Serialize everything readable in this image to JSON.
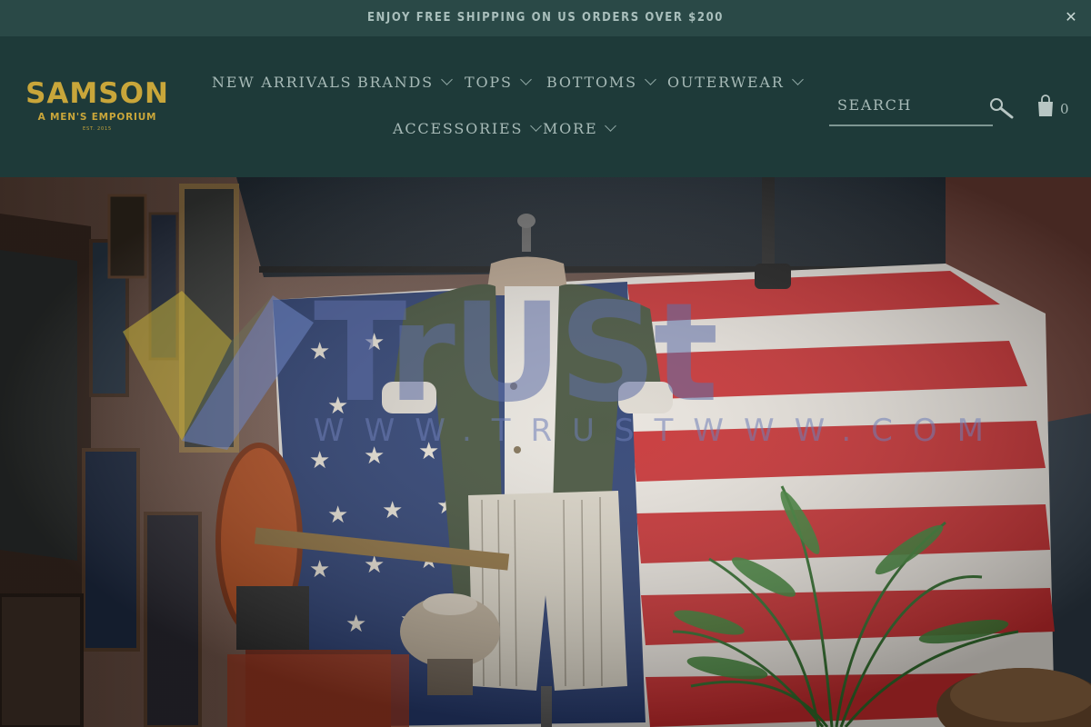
{
  "announcement": {
    "text": "ENJOY FREE SHIPPING ON US ORDERS OVER $200",
    "close_icon": "close-icon"
  },
  "logo": {
    "name": "SAMSON",
    "tagline": "A MEN'S EMPORIUM",
    "est": "EST. 2015",
    "color": "#c9a63a"
  },
  "nav": {
    "items": [
      {
        "label": "NEW ARRIVALS"
      },
      {
        "label": "BRANDS"
      },
      {
        "label": "TOPS"
      },
      {
        "label": "BOTTOMS"
      },
      {
        "label": "OUTERWEAR"
      },
      {
        "label": "ACCESSORIES"
      },
      {
        "label": "MORE"
      }
    ]
  },
  "search": {
    "placeholder": "SEARCH",
    "icon": "search-icon"
  },
  "cart": {
    "count": "0",
    "icon": "shopping-bag-icon"
  },
  "watermark": {
    "word": "TrUSt",
    "url": "WWW.TRUSTWWW.COM"
  },
  "colors": {
    "header_bg": "#1e3a39",
    "announcement_bg": "#2a4947",
    "nav_text": "#a7bab7",
    "accent_gold": "#c9a63a"
  }
}
